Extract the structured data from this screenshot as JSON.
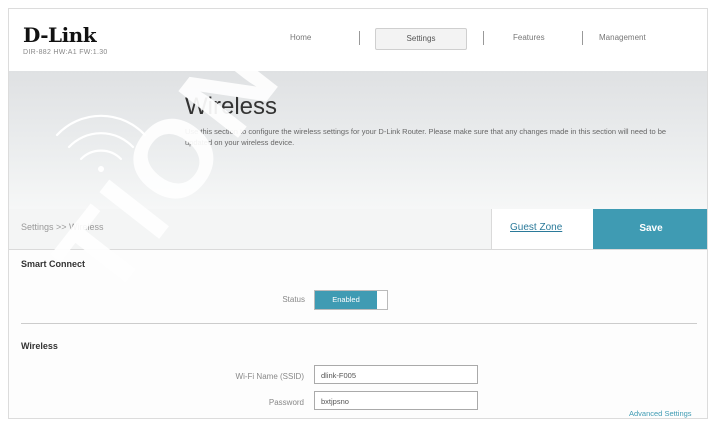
{
  "header": {
    "logo": "D-Link",
    "model": "DIR-882 HW:A1 FW:1.30",
    "nav": [
      "Home",
      "Settings",
      "Features",
      "Management"
    ]
  },
  "banner": {
    "title": "Wireless",
    "description": "Use this section to configure the wireless settings for your D-Link Router. Please make sure that any changes made in this section will need to be updated on your wireless device."
  },
  "breadcrumb": "Settings >> Wireless",
  "guest_zone_label": "Guest Zone",
  "save_label": "Save",
  "smart_connect": {
    "title": "Smart Connect",
    "status_label": "Status",
    "status_value": "Enabled"
  },
  "wireless": {
    "title": "Wireless",
    "ssid_label": "Wi-Fi Name (SSID)",
    "ssid_value": "dlink-F005",
    "password_label": "Password",
    "password_value": "bxtjpsno",
    "advanced_link": "Advanced Settings"
  },
  "watermark": "TION",
  "colors": {
    "accent": "#3f9bb3",
    "link": "#2b7a9a"
  }
}
